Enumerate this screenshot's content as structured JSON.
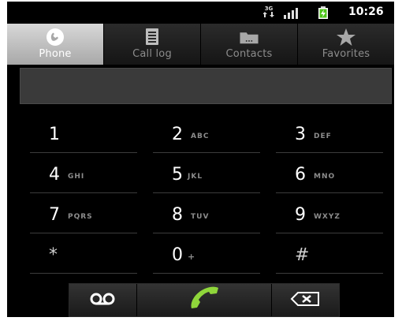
{
  "status_bar": {
    "network_label": "3G",
    "time": "10:26"
  },
  "tabs": [
    {
      "label": "Phone",
      "icon": "phone-icon",
      "active": true
    },
    {
      "label": "Call log",
      "icon": "call-log-icon",
      "active": false
    },
    {
      "label": "Contacts",
      "icon": "contacts-icon",
      "active": false
    },
    {
      "label": "Favorites",
      "icon": "star-icon",
      "active": false
    }
  ],
  "digits": {
    "value": ""
  },
  "keypad": {
    "keys": [
      {
        "digit": "1",
        "letters": ""
      },
      {
        "digit": "2",
        "letters": "ABC"
      },
      {
        "digit": "3",
        "letters": "DEF"
      },
      {
        "digit": "4",
        "letters": "GHI"
      },
      {
        "digit": "5",
        "letters": "JKL"
      },
      {
        "digit": "6",
        "letters": "MNO"
      },
      {
        "digit": "7",
        "letters": "PQRS"
      },
      {
        "digit": "8",
        "letters": "TUV"
      },
      {
        "digit": "9",
        "letters": "WXYZ"
      },
      {
        "digit": "*",
        "letters": ""
      },
      {
        "digit": "0",
        "letters": "+"
      },
      {
        "digit": "#",
        "letters": ""
      }
    ]
  },
  "actions": {
    "voicemail_icon": "voicemail-icon",
    "call_icon": "call-icon",
    "delete_icon": "backspace-icon"
  },
  "colors": {
    "call_green": "#8fd63b",
    "active_tab": "#bdbdbd",
    "screen_bg": "#000000"
  }
}
